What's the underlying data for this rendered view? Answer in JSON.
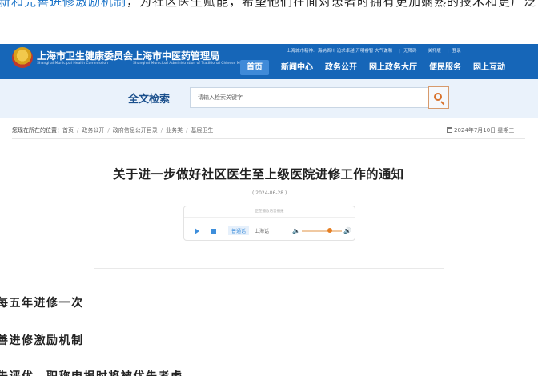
{
  "top_strip": {
    "link_text": "新和完善进修激励机制",
    "text": "，为社区医生赋能，希望他们在面对患者时拥有更加娴熟的技术和更广泛"
  },
  "header": {
    "logo1_cn": "上海市卫生健康委员会",
    "logo1_en": "Shanghai Municipal Health Commission",
    "logo2_cn": "上海市中医药管理局",
    "logo2_en": "Shanghai Municipal Administration of Traditional Chinese Medicine",
    "utility": {
      "spirit_label": "上海城市精神:",
      "spirit_text": "海纳百川 追求卓越 开明睿智 大气谦和",
      "accessible": "无障碍",
      "care": "关怀版",
      "account": "登录"
    },
    "nav": [
      "首页",
      "新闻中心",
      "政务公开",
      "网上政务大厅",
      "便民服务",
      "网上互动"
    ],
    "active_nav": "首页"
  },
  "search": {
    "title": "全文检索",
    "placeholder": "请输入检索关键字"
  },
  "breadcrumb": {
    "lead": "您现在所在的位置：",
    "items": [
      "首页",
      "政务公开",
      "政府信息公开目录",
      "业务类",
      "基层卫生"
    ]
  },
  "date_info": "2024年7月10日 星期三",
  "article": {
    "title": "关于进一步做好社区医生至上级医院进修工作的通知",
    "date": "( 2024-06-28 )"
  },
  "player": {
    "header": "正在播放语音播报",
    "voice_standard": "普通话",
    "voice_local": "上海话",
    "volume_percent": 70
  },
  "fragments": [
    "每五年进修一次",
    "善进修激励机制",
    "先评优、职称申报时将被优先考虑"
  ],
  "colors": {
    "header_blue": "#1666b8",
    "active_nav": "#3f8ad8",
    "search_band": "#eaf2fb",
    "accent_orange": "#e67e22"
  }
}
